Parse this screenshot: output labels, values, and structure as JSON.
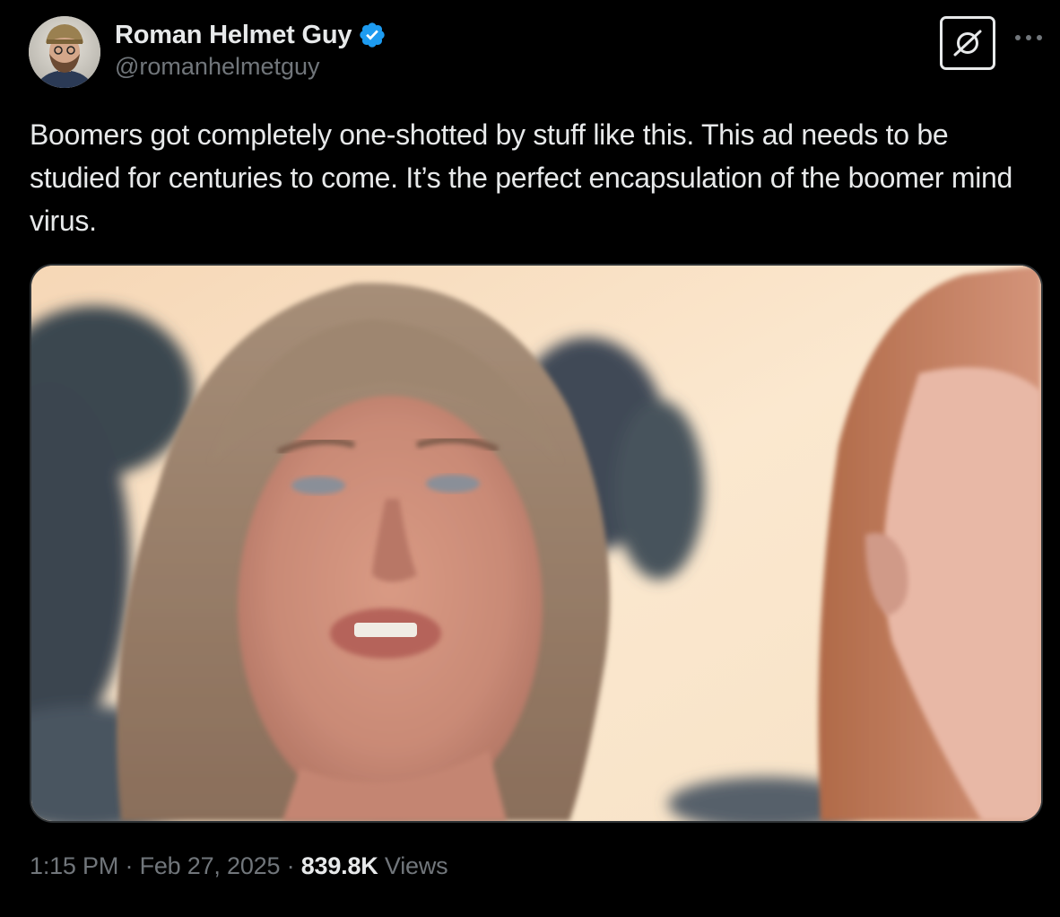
{
  "author": {
    "display_name": "Roman Helmet Guy",
    "handle": "@romanhelmetguy",
    "verified": true,
    "verified_color": "#1d9bf0"
  },
  "tweet": {
    "text": "Boomers got completely one-shotted by stuff like this. This ad needs to be studied for centuries to come. It’s the perfect encapsulation of the boomer mind virus."
  },
  "media": {
    "type": "video-still",
    "description_icon": "video-frame"
  },
  "meta": {
    "time": "1:15 PM",
    "separator": "·",
    "date": "Feb 27, 2025",
    "views_count": "839.8K",
    "views_label": "Views"
  },
  "icons": {
    "grok": "grok-icon",
    "more": "more-dots-icon",
    "verified": "verified-badge-icon"
  },
  "colors": {
    "background": "#000000",
    "text_primary": "#e7e9ea",
    "text_secondary": "#71767b",
    "border": "#2f3336"
  }
}
